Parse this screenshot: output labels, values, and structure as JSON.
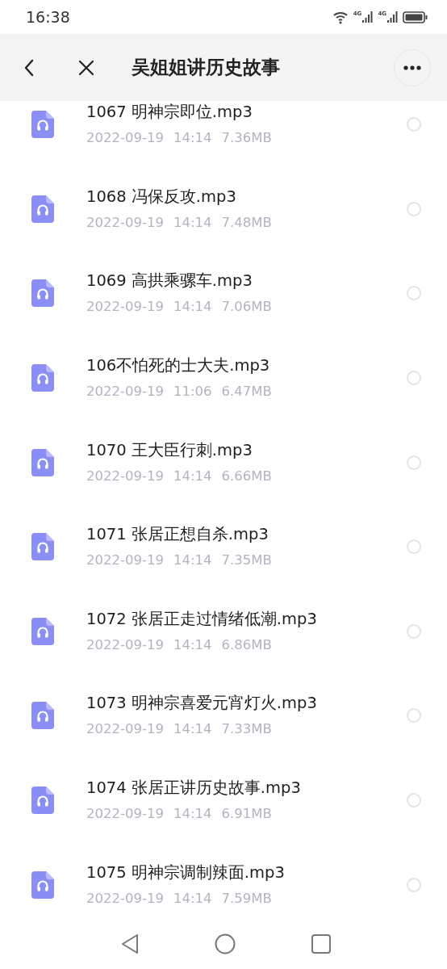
{
  "status_bar": {
    "time": "16:38",
    "network_1": "4G",
    "network_2": "4G"
  },
  "header": {
    "title": "吴姐姐讲历史故事"
  },
  "files": [
    {
      "name": "1067 明神宗即位.mp3",
      "date": "2022-09-19",
      "time": "14:14",
      "size": "7.36MB",
      "selected": false
    },
    {
      "name": "1068 冯保反攻.mp3",
      "date": "2022-09-19",
      "time": "14:14",
      "size": "7.48MB",
      "selected": false
    },
    {
      "name": "1069 高拱乘骡车.mp3",
      "date": "2022-09-19",
      "time": "14:14",
      "size": "7.06MB",
      "selected": false
    },
    {
      "name": "106不怕死的士大夫.mp3",
      "date": "2022-09-19",
      "time": "11:06",
      "size": "6.47MB",
      "selected": false
    },
    {
      "name": "1070 王大臣行刺.mp3",
      "date": "2022-09-19",
      "time": "14:14",
      "size": "6.66MB",
      "selected": false
    },
    {
      "name": "1071 张居正想自杀.mp3",
      "date": "2022-09-19",
      "time": "14:14",
      "size": "7.35MB",
      "selected": false
    },
    {
      "name": "1072 张居正走过情绪低潮.mp3",
      "date": "2022-09-19",
      "time": "14:14",
      "size": "6.86MB",
      "selected": false
    },
    {
      "name": "1073 明神宗喜爱元宵灯火.mp3",
      "date": "2022-09-19",
      "time": "14:14",
      "size": "7.33MB",
      "selected": false
    },
    {
      "name": "1074 张居正讲历史故事.mp3",
      "date": "2022-09-19",
      "time": "14:14",
      "size": "6.91MB",
      "selected": false
    },
    {
      "name": "1075 明神宗调制辣面.mp3",
      "date": "2022-09-19",
      "time": "14:14",
      "size": "7.59MB",
      "selected": false
    }
  ]
}
